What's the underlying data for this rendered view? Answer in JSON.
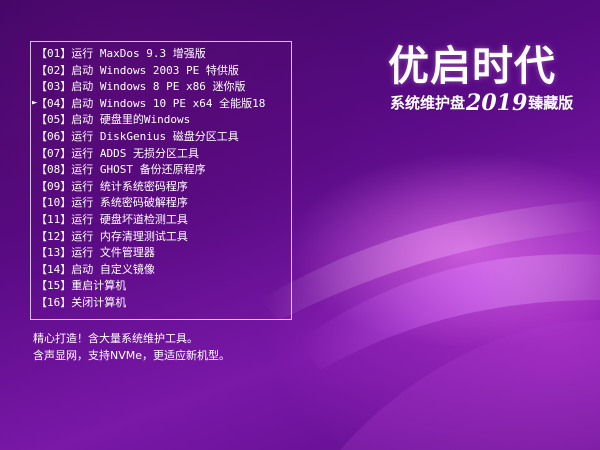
{
  "logo": {
    "title": "优启时代",
    "subtitle_pre": "系统维护盘",
    "subtitle_year": "2019",
    "subtitle_post": "臻藏版"
  },
  "menu": {
    "selected_index": 3,
    "pointer_glyph": "►",
    "items": [
      {
        "num": "01",
        "text": "运行 MaxDos 9.3 增强版"
      },
      {
        "num": "02",
        "text": "启动 Windows 2003 PE 特供版"
      },
      {
        "num": "03",
        "text": "启动 Windows 8 PE x86 迷你版"
      },
      {
        "num": "04",
        "text": "启动 Windows 10 PE x64 全能版18"
      },
      {
        "num": "05",
        "text": "启动 硬盘里的Windows"
      },
      {
        "num": "06",
        "text": "运行 DiskGenius 磁盘分区工具"
      },
      {
        "num": "07",
        "text": "运行 ADDS 无损分区工具"
      },
      {
        "num": "08",
        "text": "运行 GHOST 备份还原程序"
      },
      {
        "num": "09",
        "text": "运行 统计系统密码程序"
      },
      {
        "num": "10",
        "text": "运行 系统密码破解程序"
      },
      {
        "num": "11",
        "text": "运行 硬盘坏道检测工具"
      },
      {
        "num": "12",
        "text": "运行 内存清理测试工具"
      },
      {
        "num": "13",
        "text": "运行 文件管理器"
      },
      {
        "num": "14",
        "text": "启动 自定义镜像"
      },
      {
        "num": "15",
        "text": "重启计算机"
      },
      {
        "num": "16",
        "text": "关闭计算机"
      }
    ]
  },
  "footer": {
    "line1": "精心打造！含大量系统维护工具。",
    "line2": "含声显网，支持NVMe，更适应新机型。"
  }
}
